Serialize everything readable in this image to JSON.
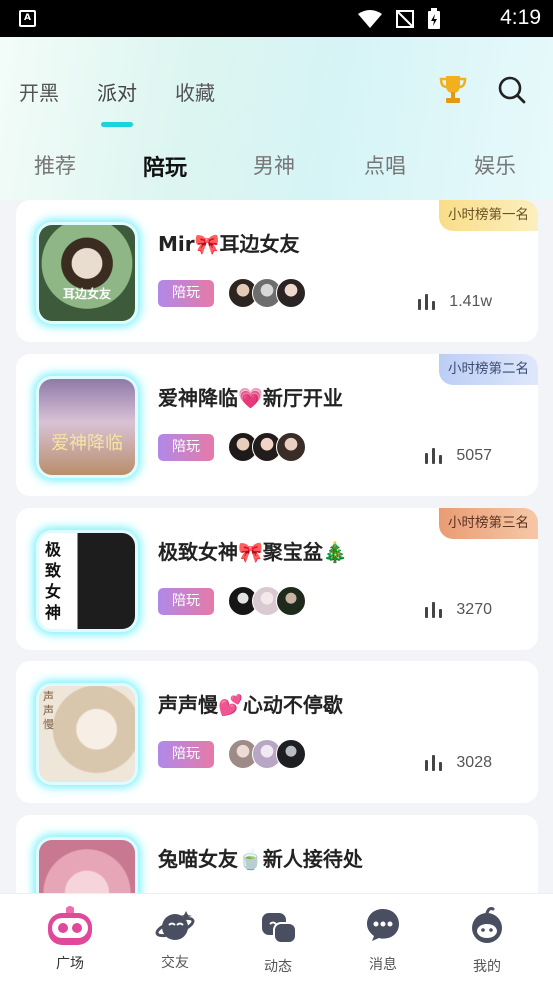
{
  "status_bar": {
    "time": "4:19",
    "app_badge": "A"
  },
  "top_tabs": [
    {
      "label": "开黑",
      "active": false
    },
    {
      "label": "派对",
      "active": true
    },
    {
      "label": "收藏",
      "active": false
    }
  ],
  "header_icons": [
    "trophy-icon",
    "search-icon"
  ],
  "sub_tabs": [
    {
      "label": "推荐",
      "active": false
    },
    {
      "label": "陪玩",
      "active": true
    },
    {
      "label": "男神",
      "active": false
    },
    {
      "label": "点唱",
      "active": false
    },
    {
      "label": "娱乐",
      "active": false
    }
  ],
  "rooms": [
    {
      "title": "Mir🎀耳边女友",
      "tag": "陪玩",
      "count": "1.41w",
      "rank": "小时榜第一名",
      "cover_text": "耳边女友",
      "colors": [
        "#3d5a3b",
        "#a6c59a"
      ]
    },
    {
      "title": "爱神降临💗新厅开业",
      "tag": "陪玩",
      "count": "5057",
      "rank": "小时榜第二名",
      "cover_text": "爱神降临",
      "colors": [
        "#6e5b8c",
        "#e8d3c4"
      ]
    },
    {
      "title": "极致女神🎀聚宝盆🎄",
      "tag": "陪玩",
      "count": "3270",
      "rank": "小时榜第三名",
      "cover_text": "极致女神",
      "colors": [
        "#ffffff",
        "#222222"
      ]
    },
    {
      "title": "声声慢💕心动不停歇",
      "tag": "陪玩",
      "count": "3028",
      "rank": "",
      "cover_text": "声声慢",
      "colors": [
        "#f0e9dd",
        "#c9b69b"
      ]
    },
    {
      "title": "兔喵女友🍵新人接待处",
      "tag": "",
      "count": "",
      "rank": "",
      "cover_text": "",
      "colors": [
        "#e7a5b8",
        "#f6d4dc"
      ]
    }
  ],
  "bottom_nav": [
    {
      "label": "广场",
      "icon": "gamepad-icon",
      "active": true
    },
    {
      "label": "交友",
      "icon": "planet-icon",
      "active": false
    },
    {
      "label": "动态",
      "icon": "chat-bubbles-icon",
      "active": false
    },
    {
      "label": "消息",
      "icon": "message-icon",
      "active": false
    },
    {
      "label": "我的",
      "icon": "profile-face-icon",
      "active": false
    }
  ],
  "colors": {
    "accent": "#1ad3dc",
    "tag_start": "#b089e8",
    "tag_end": "#e57aa8",
    "nav_active": "#e0489a"
  }
}
